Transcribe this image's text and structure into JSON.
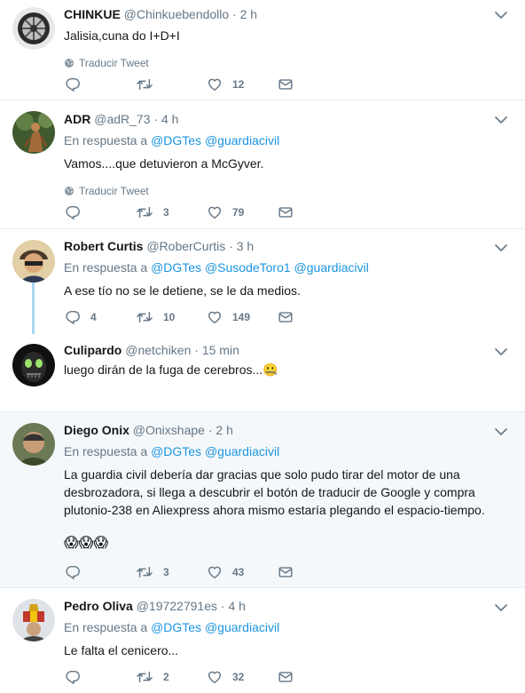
{
  "translate_label": "Traducir Tweet",
  "reply_prefix": "En respuesta a",
  "colors": {
    "link": "#1b95e0",
    "muted": "#657786",
    "thread": "#a9d6f1",
    "highlight": "#f5f8fa"
  },
  "tweets": [
    {
      "name": "CHINKUE",
      "handle": "@Chinkuebendollo",
      "time": "· 2 h",
      "text": "Jalisia,cuna do I+D+I",
      "translate": true,
      "replies": "",
      "retweets": "",
      "likes": "12"
    },
    {
      "name": "ADR",
      "handle": "@adR_73",
      "time": "· 4 h",
      "reply_to": [
        "@DGTes",
        "@guardiacivil"
      ],
      "text": "Vamos....que detuvieron a McGyver.",
      "translate": true,
      "replies": "",
      "retweets": "3",
      "likes": "79"
    },
    {
      "name": "Robert Curtis",
      "handle": "@RoberCurtis",
      "time": "· 3 h",
      "reply_to": [
        "@DGTes",
        "@SusodeToro1",
        "@guardiacivil"
      ],
      "text": "A ese tío no se le detiene, se le da medios.",
      "replies": "4",
      "retweets": "10",
      "likes": "149"
    },
    {
      "name": "Culipardo",
      "handle": "@netchiken",
      "time": "· 15 min",
      "text": "luego dirán de la fuga de cerebros...",
      "emoji": "🤐"
    },
    {
      "name": "Diego Onix",
      "handle": "@Onixshape",
      "time": "· 2 h",
      "reply_to": [
        "@DGTes",
        "@guardiacivil"
      ],
      "text": "La guardia civil debería dar gracias que solo pudo tirar del motor de una desbrozadora, si llega a descubrir el botón de traducir de Google y compra plutonio-238 en Aliexpress ahora mismo estaría plegando el espacio-tiempo.",
      "emoji_line": "😱😱😱",
      "replies": "",
      "retweets": "3",
      "likes": "43"
    },
    {
      "name": "Pedro Oliva",
      "handle": "@19722791es",
      "time": "· 4 h",
      "reply_to": [
        "@DGTes",
        "@guardiacivil"
      ],
      "text": "Le falta el cenicero...",
      "replies": "",
      "retweets": "2",
      "likes": "32"
    }
  ]
}
